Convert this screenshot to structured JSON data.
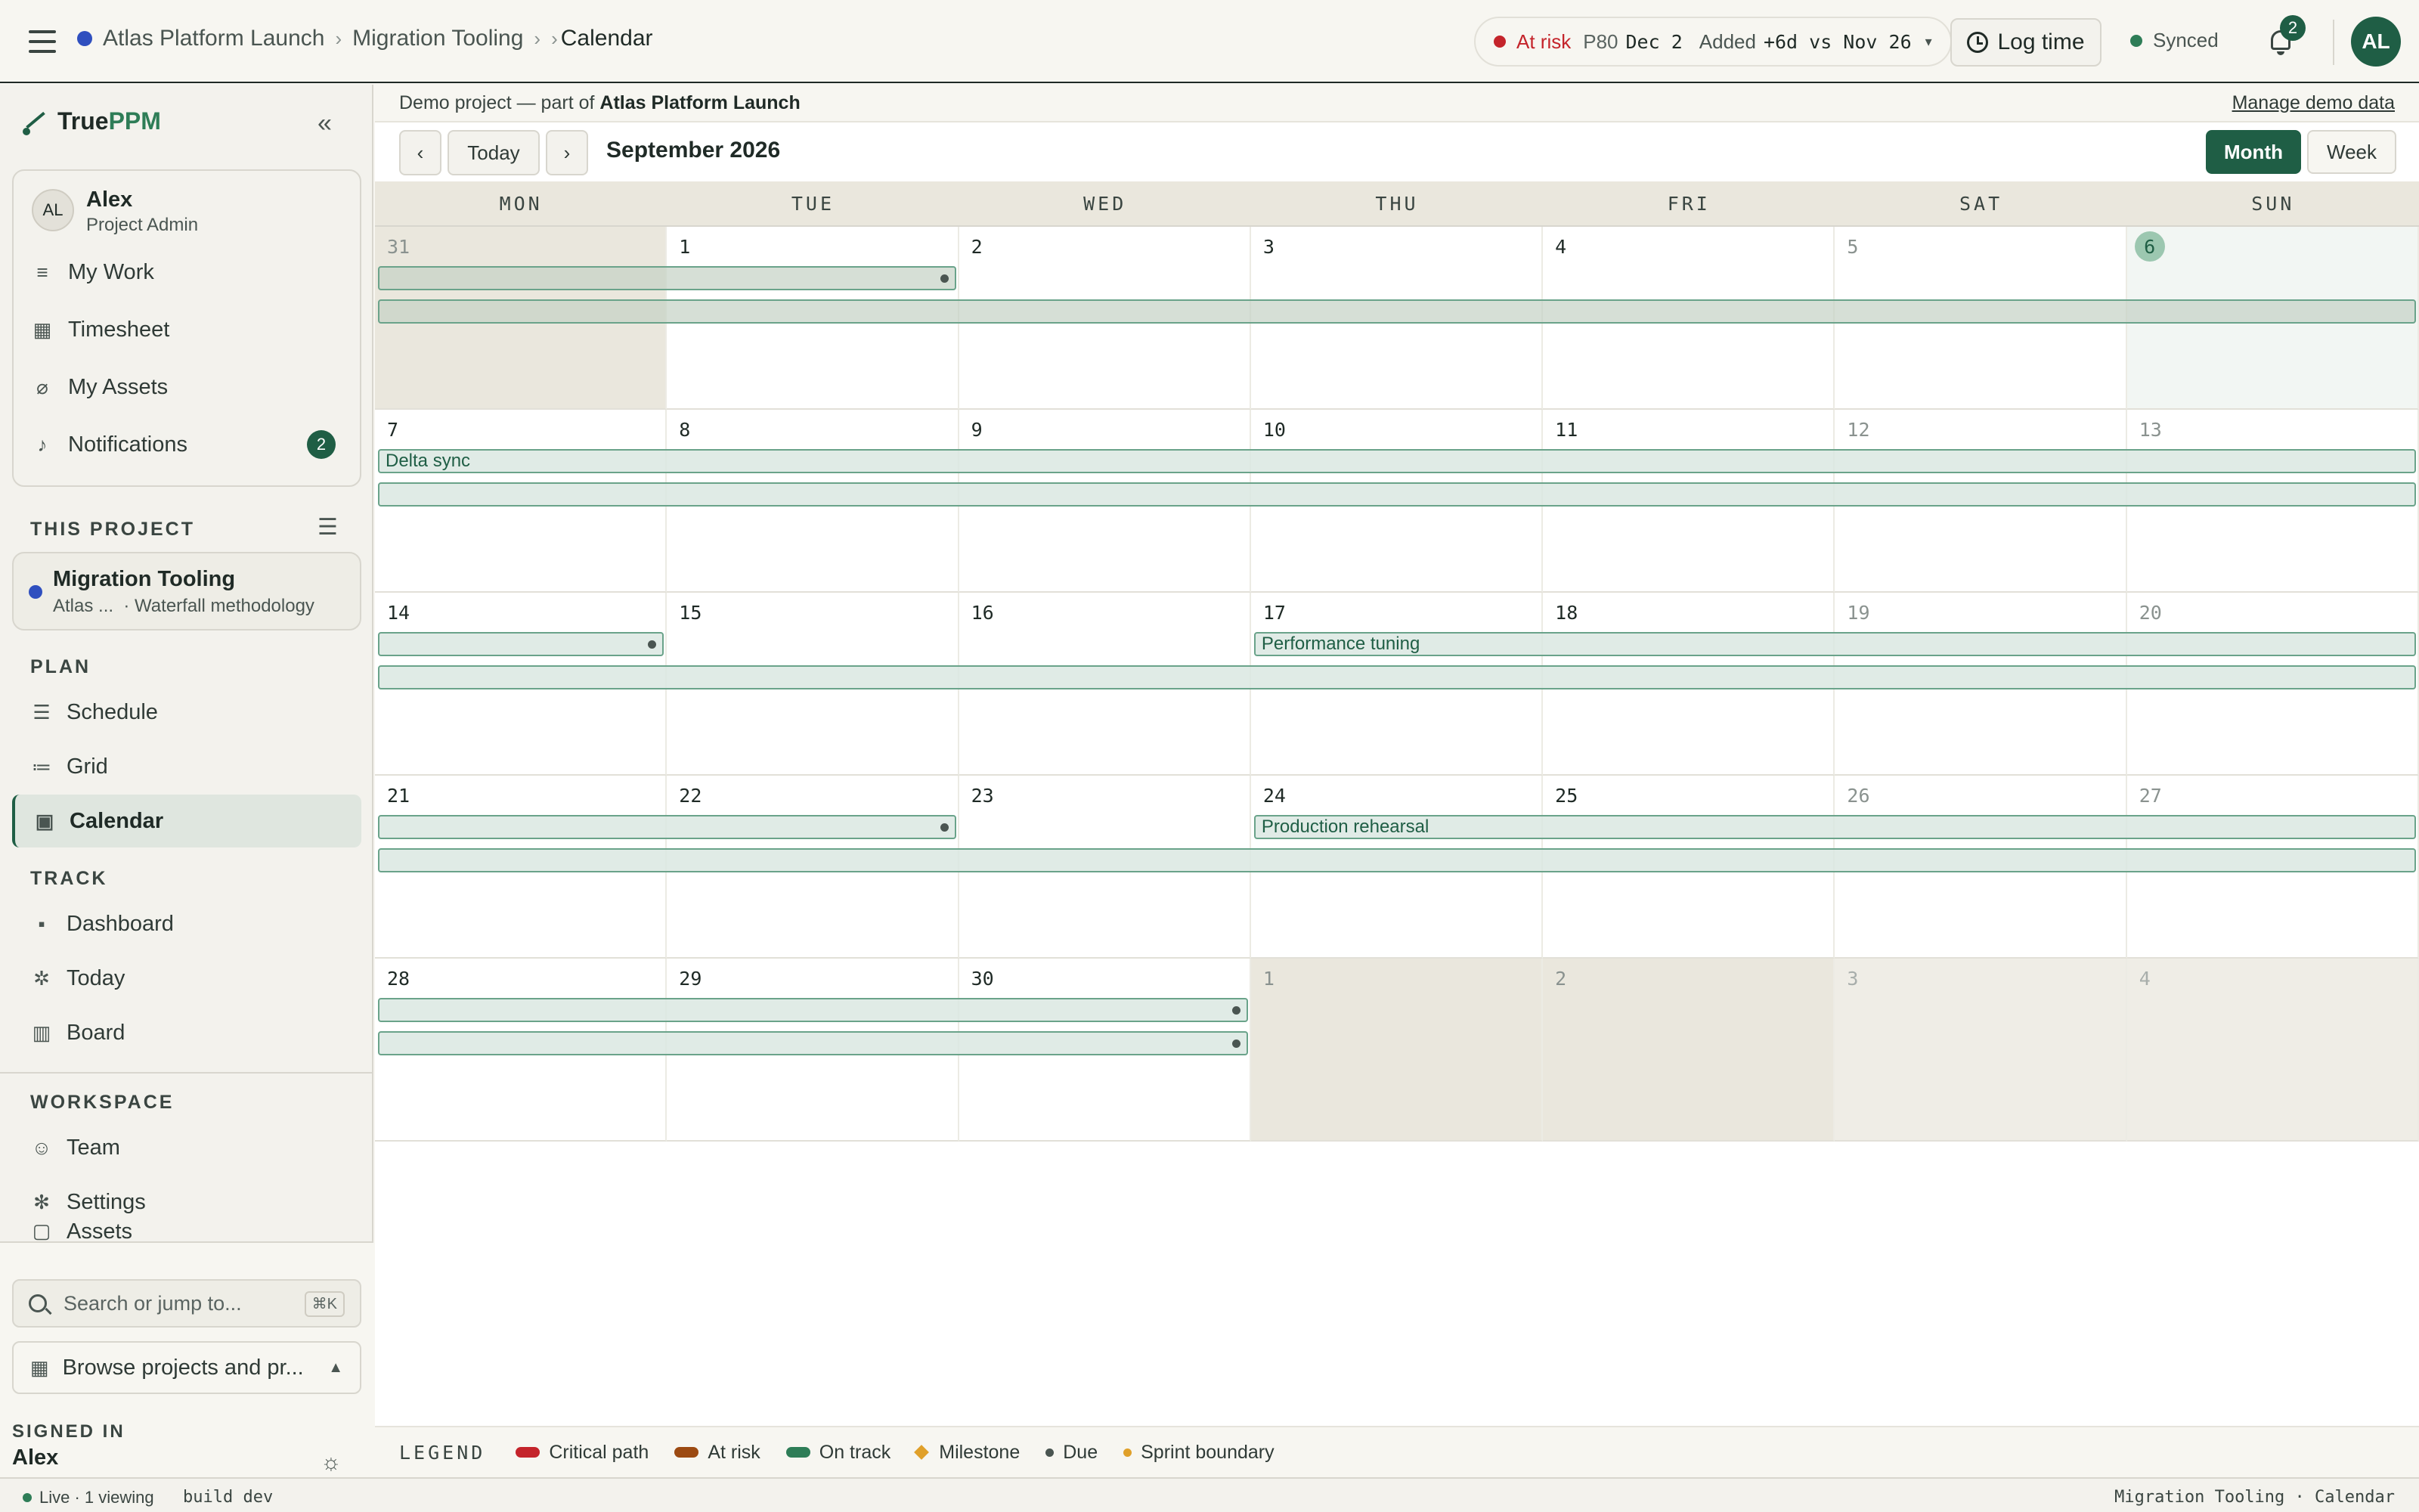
{
  "topbar": {
    "breadcrumbs": [
      "Atlas Platform Launch",
      "Migration Tooling",
      "Calendar"
    ],
    "risk": {
      "status": "At risk",
      "p80_label": "P80",
      "p80_date": "Dec 2",
      "added_label": "Added",
      "delta": "+6d vs Nov 26"
    },
    "log_time": "Log time",
    "sync_status": "Synced",
    "notifications_count": "2",
    "user_initials": "AL",
    "colors": {
      "accent": "#1f5e45",
      "risk": "#c4242b",
      "project_dot": "#2f4fbf"
    }
  },
  "sidebar": {
    "brand_a": "True",
    "brand_b": "PPM",
    "user": {
      "initials": "AL",
      "name": "Alex",
      "role": "Project Admin"
    },
    "user_items": [
      {
        "label": "My Work",
        "icon": "list-icon"
      },
      {
        "label": "Timesheet",
        "icon": "table-icon"
      },
      {
        "label": "My Assets",
        "icon": "paperclip-icon"
      },
      {
        "label": "Notifications",
        "icon": "bell-icon",
        "badge": "2"
      }
    ],
    "this_project_label": "THIS PROJECT",
    "project": {
      "name": "Migration Tooling",
      "parent": "Atlas ...",
      "methodology": "· Waterfall methodology"
    },
    "plan_label": "PLAN",
    "plan_items": [
      {
        "label": "Schedule",
        "icon": "gantt-icon"
      },
      {
        "label": "Grid",
        "icon": "list-icon"
      },
      {
        "label": "Calendar",
        "icon": "calendar-icon",
        "active": true
      }
    ],
    "track_label": "TRACK",
    "track_items": [
      {
        "label": "Dashboard",
        "icon": "dashboard-icon"
      },
      {
        "label": "Today",
        "icon": "sun-icon"
      },
      {
        "label": "Board",
        "icon": "board-icon"
      }
    ],
    "workspace_label": "WORKSPACE",
    "workspace_items": [
      {
        "label": "Team",
        "icon": "people-icon"
      },
      {
        "label": "Settings",
        "icon": "gear-icon"
      },
      {
        "label": "Assets",
        "icon": "box-icon"
      }
    ],
    "search_placeholder": "Search or jump to...",
    "search_shortcut": "⌘K",
    "browse_label": "Browse projects and pr...",
    "signed_in_label": "SIGNED IN",
    "signed_in_name": "Alex"
  },
  "main": {
    "demo_prefix": "Demo project — part of",
    "demo_parent": "Atlas Platform Launch",
    "manage_demo": "Manage demo data",
    "today_button": "Today",
    "month_title": "September 2026",
    "views": [
      "Month",
      "Week"
    ],
    "active_view": "Month",
    "weekdays": [
      "MON",
      "TUE",
      "WED",
      "THU",
      "FRI",
      "SAT",
      "SUN"
    ],
    "weeks": [
      [
        {
          "day": "31",
          "type": "other"
        },
        {
          "day": "1"
        },
        {
          "day": "2"
        },
        {
          "day": "3"
        },
        {
          "day": "4"
        },
        {
          "day": "5",
          "type": "weekend"
        },
        {
          "day": "6",
          "type": "today"
        }
      ],
      [
        {
          "day": "7"
        },
        {
          "day": "8"
        },
        {
          "day": "9"
        },
        {
          "day": "10"
        },
        {
          "day": "11"
        },
        {
          "day": "12",
          "type": "weekend"
        },
        {
          "day": "13",
          "type": "weekend"
        }
      ],
      [
        {
          "day": "14"
        },
        {
          "day": "15"
        },
        {
          "day": "16"
        },
        {
          "day": "17"
        },
        {
          "day": "18"
        },
        {
          "day": "19",
          "type": "weekend"
        },
        {
          "day": "20",
          "type": "weekend"
        }
      ],
      [
        {
          "day": "21"
        },
        {
          "day": "22"
        },
        {
          "day": "23"
        },
        {
          "day": "24"
        },
        {
          "day": "25"
        },
        {
          "day": "26",
          "type": "weekend"
        },
        {
          "day": "27",
          "type": "weekend"
        }
      ],
      [
        {
          "day": "28"
        },
        {
          "day": "29"
        },
        {
          "day": "30"
        },
        {
          "day": "1",
          "type": "other"
        },
        {
          "day": "2",
          "type": "other"
        },
        {
          "day": "3",
          "type": "other-we"
        },
        {
          "day": "4",
          "type": "other-we"
        }
      ]
    ],
    "events": [
      {
        "week": 0,
        "lane": 0,
        "start": 0,
        "end": 1,
        "label": "",
        "due": true
      },
      {
        "week": 0,
        "lane": 1,
        "start": 0,
        "end": 6,
        "label": "",
        "due": false
      },
      {
        "week": 1,
        "lane": 0,
        "start": 0,
        "end": 6,
        "label": "Delta sync",
        "due": false
      },
      {
        "week": 1,
        "lane": 1,
        "start": 0,
        "end": 6,
        "label": "",
        "due": false
      },
      {
        "week": 2,
        "lane": 0,
        "start": 0,
        "end": 0,
        "label": "",
        "due": true
      },
      {
        "week": 2,
        "lane": 0,
        "start": 3,
        "end": 6,
        "label": "Performance tuning",
        "due": false
      },
      {
        "week": 2,
        "lane": 1,
        "start": 0,
        "end": 6,
        "label": "",
        "due": false
      },
      {
        "week": 3,
        "lane": 0,
        "start": 0,
        "end": 1,
        "label": "",
        "due": true
      },
      {
        "week": 3,
        "lane": 0,
        "start": 3,
        "end": 6,
        "label": "Production rehearsal",
        "due": false
      },
      {
        "week": 3,
        "lane": 1,
        "start": 0,
        "end": 6,
        "label": "",
        "due": false
      },
      {
        "week": 4,
        "lane": 0,
        "start": 0,
        "end": 2,
        "label": "",
        "due": true
      },
      {
        "week": 4,
        "lane": 1,
        "start": 0,
        "end": 2,
        "label": "",
        "due": true
      }
    ],
    "legend_title": "LEGEND",
    "legend": [
      {
        "label": "Critical path",
        "kind": "pill",
        "color": "#c4242b"
      },
      {
        "label": "At risk",
        "kind": "pill",
        "color": "#9c4a12"
      },
      {
        "label": "On track",
        "kind": "pill",
        "color": "#2e7d57"
      },
      {
        "label": "Milestone",
        "kind": "diamond",
        "color": "#e0a02a"
      },
      {
        "label": "Due",
        "kind": "dot",
        "color": "#4a5551"
      },
      {
        "label": "Sprint boundary",
        "kind": "dot",
        "color": "#e0a02a"
      }
    ]
  },
  "statusbar": {
    "live": "Live · 1 viewing",
    "build": "build dev",
    "context": "Migration Tooling · Calendar"
  }
}
